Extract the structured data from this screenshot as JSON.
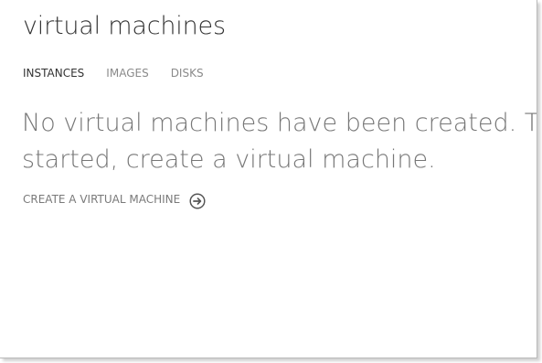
{
  "page": {
    "title": "virtual machines"
  },
  "tabs": [
    {
      "label": "INSTANCES",
      "active": true
    },
    {
      "label": "IMAGES",
      "active": false
    },
    {
      "label": "DISKS",
      "active": false
    }
  ],
  "empty_state": {
    "message": "No virtual machines have been created. To get started, create a virtual machine.",
    "action_label": "CREATE A VIRTUAL MACHINE",
    "action_icon": "arrow-circle-right-icon"
  },
  "colors": {
    "title": "#333333",
    "tab_active": "#333333",
    "tab_inactive": "#8a8a8a",
    "message": "#777777"
  }
}
